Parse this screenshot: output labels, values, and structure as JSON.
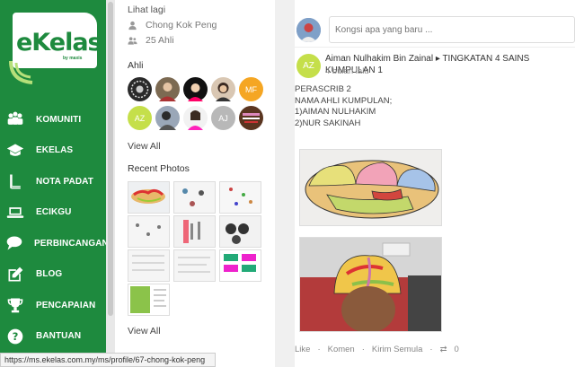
{
  "logo": {
    "text": "eKelas",
    "sub": "by maxis"
  },
  "nav": [
    {
      "label": "KOMUNITI",
      "icon": "community-icon"
    },
    {
      "label": "EKELAS",
      "icon": "graduation-cap-icon"
    },
    {
      "label": "NOTA PADAT",
      "icon": "book-icon"
    },
    {
      "label": "ECIKGU",
      "icon": "laptop-icon"
    },
    {
      "label": "PERBINCANGAN",
      "icon": "chat-icon"
    },
    {
      "label": "BLOG",
      "icon": "edit-icon"
    },
    {
      "label": "PENCAPAIAN",
      "icon": "trophy-icon"
    },
    {
      "label": "BANTUAN",
      "icon": "help-icon"
    }
  ],
  "group_info": {
    "see_more": "Lihat lagi",
    "owner": "Chong Kok Peng",
    "members_count": "25 Ahli",
    "members_title": "Ahli",
    "view_all_members": "View All",
    "recent_photos_title": "Recent Photos",
    "view_all_photos": "View All",
    "member_initials": [
      "MF",
      "AZ",
      "AJ"
    ]
  },
  "compose": {
    "placeholder": "Kongsi apa yang baru ..."
  },
  "post": {
    "avatar_initials": "AZ",
    "author_line": "Aiman Nulhakim Bin Zainal ▸ TINGKATAN 4 SAINS KUMPULAN 1",
    "time": "4 bulan lalu",
    "body": [
      "PERASCRIB 2",
      "NAMA AHLI KUMPULAN;",
      "1)AIMAN NULHAKIM",
      "2)NUR SAKINAH"
    ],
    "actions": {
      "like": "Like",
      "comment": "Komen",
      "share": "Kirim Semula",
      "reshare_count": "0"
    }
  },
  "statusbar": {
    "url": "https://ms.ekelas.com.my/ms/profile/67-chong-kok-peng"
  },
  "colors": {
    "sidebar": "#1e8a3e",
    "accent_green": "#c5df4a",
    "orange_avatar": "#f5a623"
  }
}
